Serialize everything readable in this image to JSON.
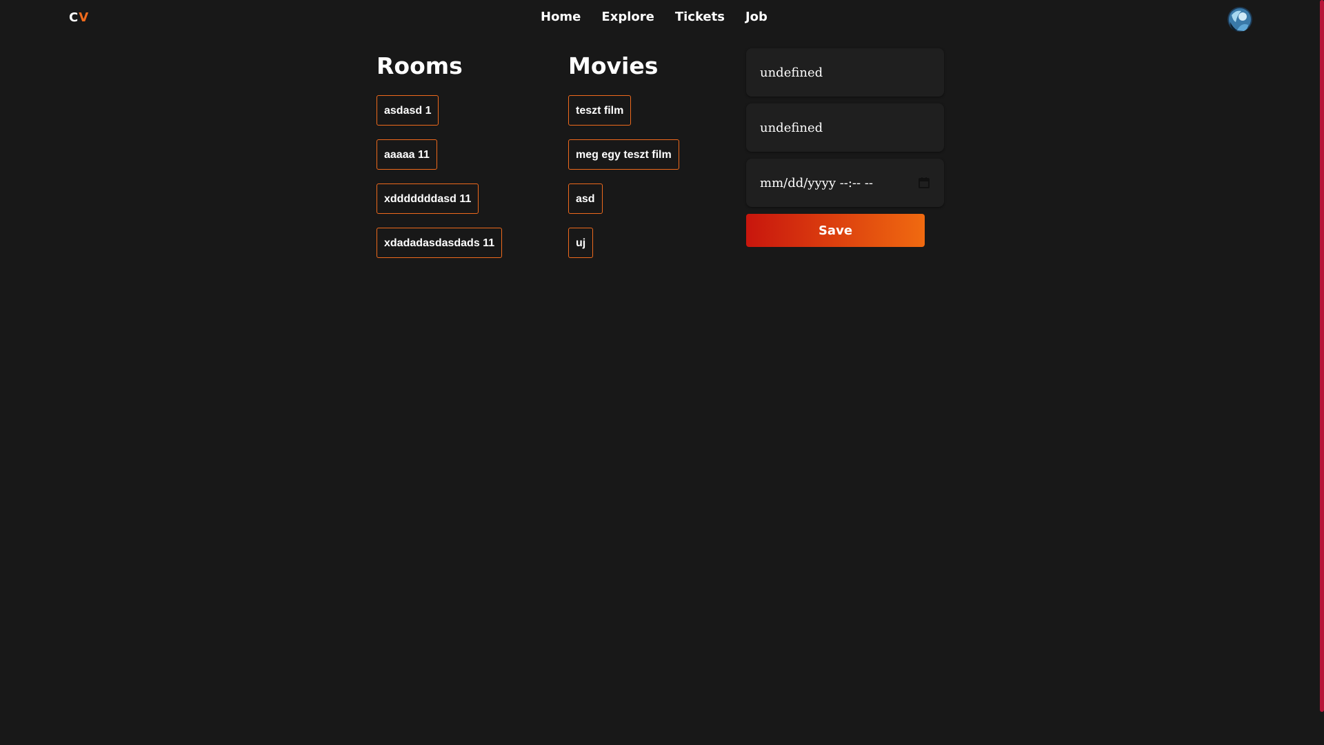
{
  "brand": {
    "logo_c": "C",
    "logo_v": "V",
    "accent_color": "#f06a1c"
  },
  "nav": {
    "items": [
      {
        "label": "Home"
      },
      {
        "label": "Explore"
      },
      {
        "label": "Tickets"
      },
      {
        "label": "Job"
      }
    ]
  },
  "user": {
    "avatar_icon": "user-avatar-icon"
  },
  "rooms": {
    "title": "Rooms",
    "items": [
      {
        "label": "asdasd 1"
      },
      {
        "label": "aaaaa 11"
      },
      {
        "label": "xdddddddasd 11"
      },
      {
        "label": "xdadadasdasdads 11"
      }
    ]
  },
  "movies": {
    "title": "Movies",
    "items": [
      {
        "label": "teszt film"
      },
      {
        "label": "meg egy teszt film"
      },
      {
        "label": "asd"
      },
      {
        "label": "uj"
      }
    ]
  },
  "form": {
    "room_value": "undefined",
    "movie_value": "undefined",
    "datetime_placeholder": "mm/dd/yyyy --:-- --",
    "save_label": "Save"
  }
}
